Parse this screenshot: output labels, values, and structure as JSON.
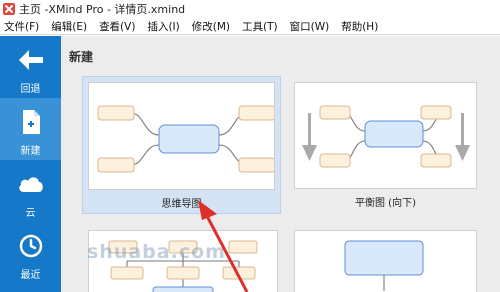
{
  "window": {
    "title": "主页 -XMind Pro - 详情页.xmind",
    "logo_icon": "xmind-logo-icon"
  },
  "menu": {
    "items": [
      {
        "label": "文件(F)"
      },
      {
        "label": "编辑(E)"
      },
      {
        "label": "查看(V)"
      },
      {
        "label": "插入(I)"
      },
      {
        "label": "修改(M)"
      },
      {
        "label": "工具(T)"
      },
      {
        "label": "窗口(W)"
      },
      {
        "label": "帮助(H)"
      }
    ]
  },
  "sidebar": {
    "items": [
      {
        "label": "回退",
        "icon": "back-arrow-icon"
      },
      {
        "label": "新建",
        "icon": "new-file-icon",
        "active": true
      },
      {
        "label": "云",
        "icon": "cloud-icon"
      },
      {
        "label": "最近",
        "icon": "clock-icon"
      }
    ]
  },
  "main": {
    "section_title": "新建",
    "templates": [
      {
        "label": "思维导图",
        "selected": true
      },
      {
        "label": "平衡图 (向下)",
        "selected": false
      },
      {
        "label": "",
        "selected": false
      },
      {
        "label": "",
        "selected": false
      }
    ]
  },
  "watermark": "shuaba.com",
  "colors": {
    "sidebar": "#1578c8",
    "sidebar_active": "#3a92d6",
    "central_topic_fill": "#d9e8fb",
    "central_topic_stroke": "#5b8fd0",
    "subtopic_fill": "#fdf0dc",
    "subtopic_stroke": "#d8b98d",
    "arrow": "#e02f2a"
  }
}
